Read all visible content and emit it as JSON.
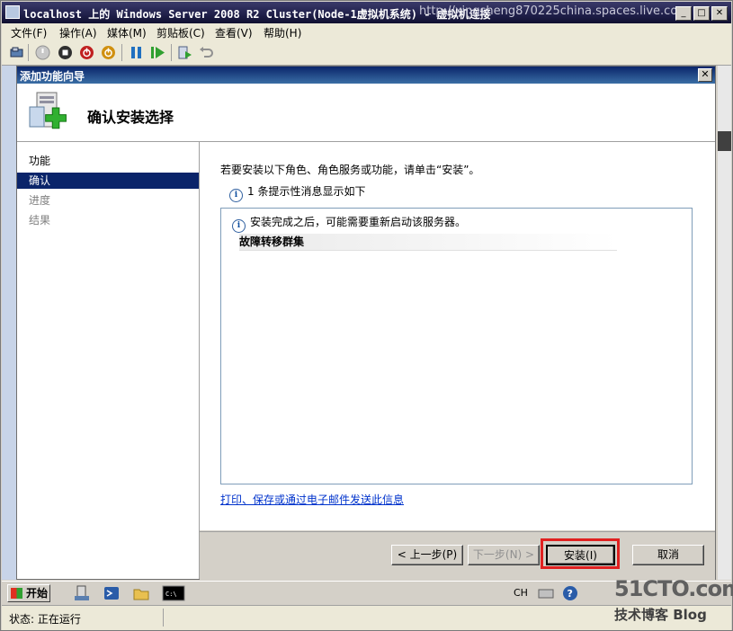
{
  "vm_window": {
    "title": "localhost 上的 Windows Server 2008 R2 Cluster(Node-1虚拟机系统) - 虚拟机连接",
    "watermark": "http://xingsheng870225china.spaces.live.com",
    "controls": {
      "minimize": "_",
      "restore": "□",
      "close": "✕"
    }
  },
  "menubar": {
    "items": [
      "文件(F)",
      "操作(A)",
      "媒体(M)",
      "剪贴板(C)",
      "查看(V)",
      "帮助(H)"
    ]
  },
  "toolbar": {
    "icons": [
      "ctrl-alt-del-icon",
      "start-icon",
      "turn-off-icon",
      "shutdown-icon",
      "save-icon",
      "pause-icon",
      "resume-icon",
      "snapshot-icon",
      "revert-icon"
    ]
  },
  "wizard": {
    "title": "添加功能向导",
    "close_label": "✕",
    "header_title": "确认安装选择",
    "nav": [
      {
        "label": "功能",
        "state": "done"
      },
      {
        "label": "确认",
        "state": "active"
      },
      {
        "label": "进度",
        "state": "pending"
      },
      {
        "label": "结果",
        "state": "pending"
      }
    ],
    "intro": "若要安装以下角色、角色服务或功能，请单击“安装”。",
    "info_summary": "1 条提示性消息显示如下",
    "info_glyph": "i",
    "result_message": "安装完成之后，可能需要重新启动该服务器。",
    "feature_name": "故障转移群集",
    "print_link": "打印、保存或通过电子邮件发送此信息",
    "buttons": {
      "prev": "< 上一步(P)",
      "next": "下一步(N) >",
      "install": "安装(I)",
      "cancel": "取消"
    }
  },
  "taskbar": {
    "start_label": "开始",
    "lang": "CH",
    "watermark_site": "51CTO.com",
    "watermark_blog": "技术博客 Blog"
  },
  "statusbar": {
    "status": "状态: 正在运行"
  },
  "colors": {
    "highlight_box": "#e02020",
    "nav_active": "#0a246a",
    "link": "#0033cc"
  }
}
